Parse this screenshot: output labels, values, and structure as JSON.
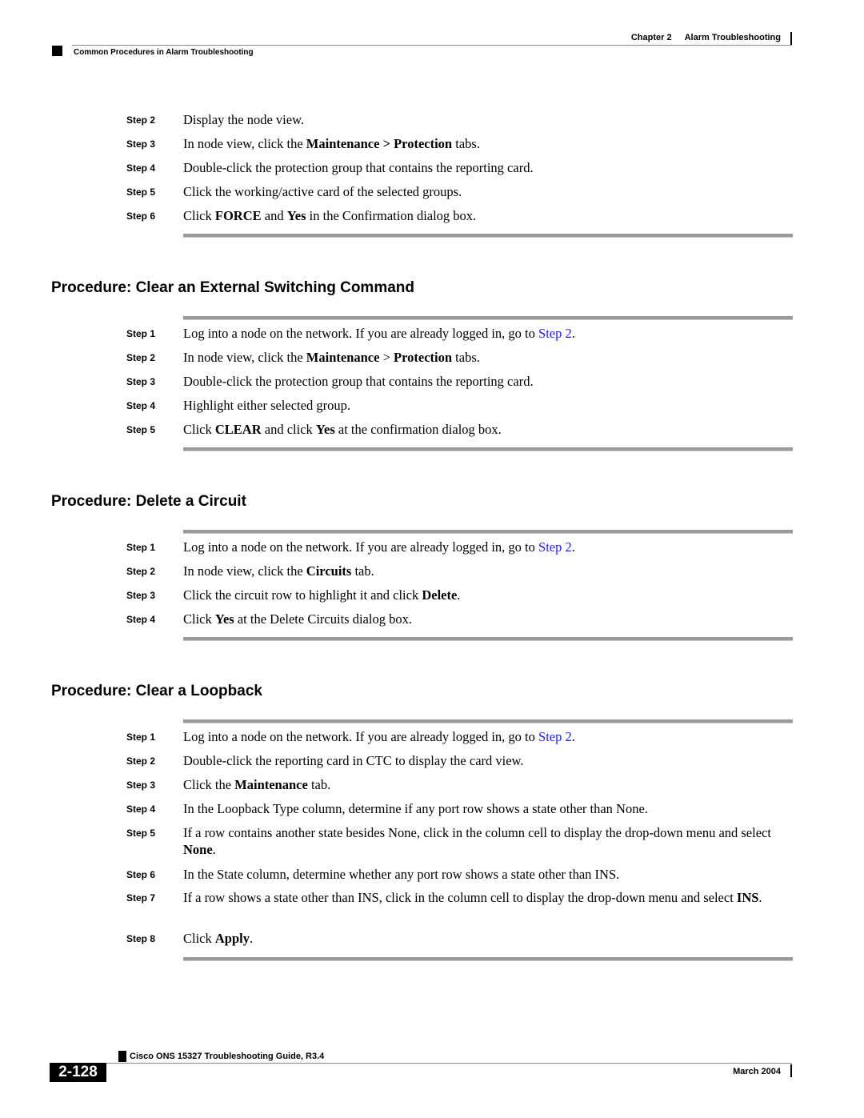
{
  "header": {
    "chapter_label": "Chapter 2",
    "chapter_title": "Alarm Troubleshooting",
    "section_title": "Common Procedures in Alarm Troubleshooting"
  },
  "continued_steps": [
    {
      "label": "Step 2",
      "parts": [
        {
          "t": "Display the node view."
        }
      ]
    },
    {
      "label": "Step 3",
      "parts": [
        {
          "t": "In node view, click the "
        },
        {
          "t": "Maintenance > Protection",
          "b": true
        },
        {
          "t": " tabs."
        }
      ]
    },
    {
      "label": "Step 4",
      "parts": [
        {
          "t": "Double-click the protection group that contains the reporting card."
        }
      ]
    },
    {
      "label": "Step 5",
      "parts": [
        {
          "t": "Click the working/active card of the selected groups."
        }
      ]
    },
    {
      "label": "Step 6",
      "parts": [
        {
          "t": "Click "
        },
        {
          "t": "FORCE",
          "b": true
        },
        {
          "t": " and "
        },
        {
          "t": "Yes",
          "b": true
        },
        {
          "t": " in the Confirmation dialog box."
        }
      ]
    }
  ],
  "procedures": [
    {
      "title": "Procedure: Clear an External Switching Command",
      "steps": [
        {
          "label": "Step 1",
          "parts": [
            {
              "t": "Log into a node on the network. If you are already logged in, go to "
            },
            {
              "t": "Step 2",
              "link": true
            },
            {
              "t": "."
            }
          ]
        },
        {
          "label": "Step 2",
          "parts": [
            {
              "t": "In node view, click the "
            },
            {
              "t": "Maintenance",
              "b": true
            },
            {
              "t": " > "
            },
            {
              "t": "Protection",
              "b": true
            },
            {
              "t": " tabs."
            }
          ]
        },
        {
          "label": "Step 3",
          "parts": [
            {
              "t": "Double-click the protection group that contains the reporting card."
            }
          ]
        },
        {
          "label": "Step 4",
          "parts": [
            {
              "t": "Highlight either selected group."
            }
          ]
        },
        {
          "label": "Step 5",
          "parts": [
            {
              "t": "Click "
            },
            {
              "t": "CLEAR",
              "b": true
            },
            {
              "t": " and click "
            },
            {
              "t": "Yes",
              "b": true
            },
            {
              "t": " at the confirmation dialog box."
            }
          ]
        }
      ]
    },
    {
      "title": "Procedure: Delete a Circuit",
      "steps": [
        {
          "label": "Step 1",
          "parts": [
            {
              "t": "Log into a node on the network. If you are already logged in, go to "
            },
            {
              "t": "Step 2",
              "link": true
            },
            {
              "t": "."
            }
          ]
        },
        {
          "label": "Step 2",
          "parts": [
            {
              "t": "In node view, click the "
            },
            {
              "t": "Circuits",
              "b": true
            },
            {
              "t": " tab."
            }
          ]
        },
        {
          "label": "Step 3",
          "parts": [
            {
              "t": "Click the circuit row to highlight it and click "
            },
            {
              "t": "Delete",
              "b": true
            },
            {
              "t": "."
            }
          ]
        },
        {
          "label": "Step 4",
          "parts": [
            {
              "t": "Click "
            },
            {
              "t": "Yes",
              "b": true
            },
            {
              "t": " at the Delete Circuits dialog box."
            }
          ]
        }
      ]
    },
    {
      "title": "Procedure: Clear a Loopback",
      "steps": [
        {
          "label": "Step 1",
          "parts": [
            {
              "t": "Log into a node on the network. If you are already logged in, go to "
            },
            {
              "t": "Step 2",
              "link": true
            },
            {
              "t": "."
            }
          ]
        },
        {
          "label": "Step 2",
          "parts": [
            {
              "t": "Double-click the reporting card in CTC to display the card view."
            }
          ]
        },
        {
          "label": "Step 3",
          "parts": [
            {
              "t": "Click the "
            },
            {
              "t": "Maintenance",
              "b": true
            },
            {
              "t": " tab."
            }
          ]
        },
        {
          "label": "Step 4",
          "parts": [
            {
              "t": "In the Loopback Type column, determine if any port row shows a state other than None."
            }
          ]
        },
        {
          "label": "Step 5",
          "parts": [
            {
              "t": "If a row contains another state besides None, click in the column cell to display the drop-down menu and select "
            },
            {
              "t": "None",
              "b": true
            },
            {
              "t": "."
            }
          ]
        },
        {
          "label": "Step 6",
          "parts": [
            {
              "t": "In the State column, determine whether any port row shows a state other than INS."
            }
          ]
        },
        {
          "label": "Step 7",
          "parts": [
            {
              "t": "If a row shows a state other than INS, click in the column cell to display the drop-down menu and select "
            },
            {
              "t": "INS",
              "b": true
            },
            {
              "t": "."
            }
          ]
        },
        {
          "label": "Step 8",
          "parts": [
            {
              "t": "Click "
            },
            {
              "t": "Apply",
              "b": true
            },
            {
              "t": "."
            }
          ]
        }
      ]
    }
  ],
  "footer": {
    "guide_title": "Cisco ONS 15327 Troubleshooting Guide, R3.4",
    "page_number": "2-128",
    "date": "March 2004"
  },
  "colors": {
    "link": "#1a1aff",
    "rule": "#9a9a9a"
  }
}
